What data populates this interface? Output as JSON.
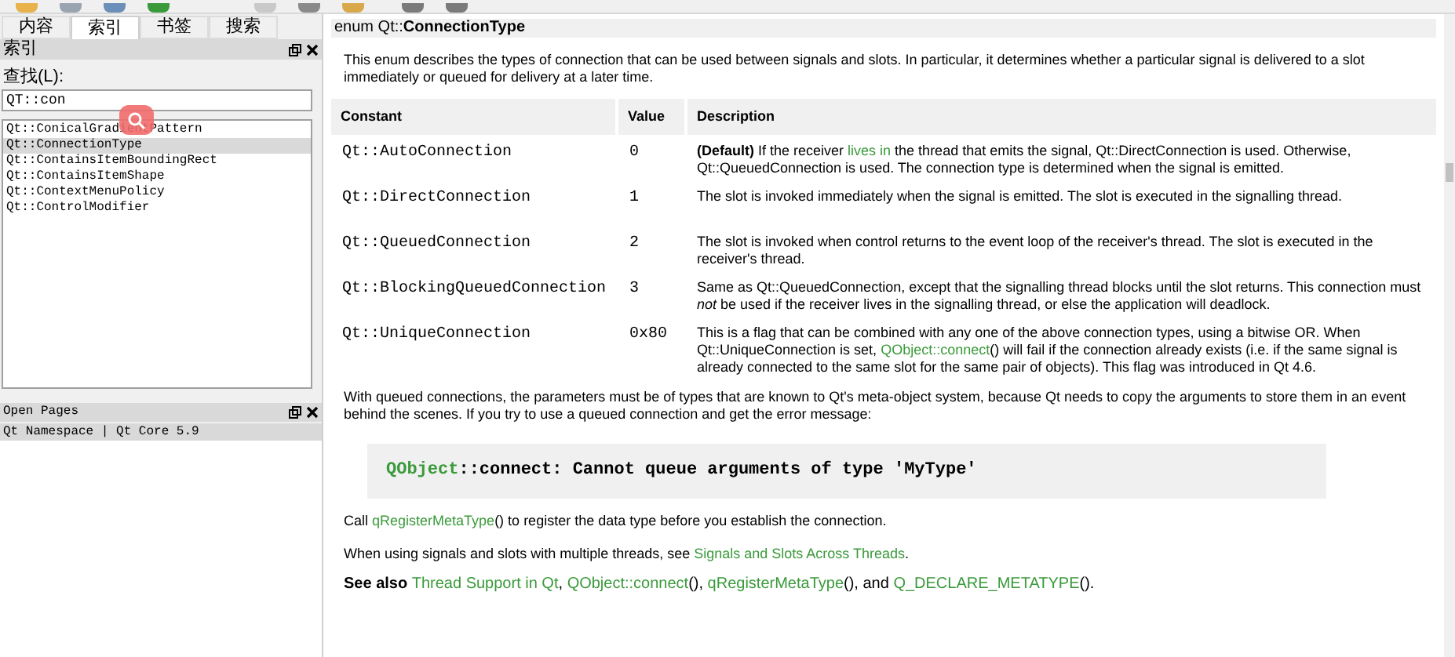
{
  "sidebar": {
    "tabs": [
      {
        "label": "内容",
        "selected": false
      },
      {
        "label": "索引",
        "selected": true
      },
      {
        "label": "书签",
        "selected": false
      },
      {
        "label": "搜索",
        "selected": false
      }
    ],
    "index_panel": {
      "title": "索引",
      "find_label": "查找(L):",
      "search_value": "QT::con",
      "items": [
        {
          "label": "Qt::ConicalGradientPattern",
          "selected": false
        },
        {
          "label": "Qt::ConnectionType",
          "selected": true
        },
        {
          "label": "Qt::ContainsItemBoundingRect",
          "selected": false
        },
        {
          "label": "Qt::ContainsItemShape",
          "selected": false
        },
        {
          "label": "Qt::ContextMenuPolicy",
          "selected": false
        },
        {
          "label": "Qt::ControlModifier",
          "selected": false
        }
      ]
    },
    "open_pages": {
      "title": "Open Pages",
      "items": [
        {
          "label": "Qt Namespace | Qt Core 5.9",
          "selected": true
        }
      ]
    }
  },
  "document": {
    "heading": [
      {
        "kind": "text",
        "text": "enum Qt::"
      },
      {
        "kind": "bold",
        "text": "ConnectionType"
      }
    ],
    "intro": [
      {
        "kind": "text",
        "text": "This enum describes the types of connection that can be used between signals and slots. In particular, it determines whether a particular signal is delivered to a slot immediately or queued for delivery at a later time."
      }
    ],
    "table": {
      "columns": [
        "Constant",
        "Value",
        "Description"
      ],
      "rows": [
        {
          "constant": "Qt::AutoConnection",
          "value": "0",
          "description": [
            {
              "kind": "bold",
              "text": "(Default)"
            },
            {
              "kind": "text",
              "text": " If the receiver "
            },
            {
              "kind": "link",
              "text": "lives in"
            },
            {
              "kind": "text",
              "text": " the thread that emits the signal, Qt::DirectConnection is used. Otherwise, Qt::QueuedConnection is used. The connection type is determined when the signal is emitted."
            }
          ]
        },
        {
          "constant": "Qt::DirectConnection",
          "value": "1",
          "description": [
            {
              "kind": "text",
              "text": "The slot is invoked immediately when the signal is emitted. The slot is executed in the signalling thread."
            }
          ]
        },
        {
          "constant": "Qt::QueuedConnection",
          "value": "2",
          "description": [
            {
              "kind": "text",
              "text": "The slot is invoked when control returns to the event loop of the receiver's thread. The slot is executed in the receiver's thread."
            }
          ]
        },
        {
          "constant": "Qt::BlockingQueuedConnection",
          "value": "3",
          "description": [
            {
              "kind": "text",
              "text": "Same as Qt::QueuedConnection, except that the signalling thread blocks until the slot returns. This connection must "
            },
            {
              "kind": "italic",
              "text": "not"
            },
            {
              "kind": "text",
              "text": " be used if the receiver lives in the signalling thread, or else the application will deadlock."
            }
          ]
        },
        {
          "constant": "Qt::UniqueConnection",
          "value": "0x80",
          "description": [
            {
              "kind": "text",
              "text": "This is a flag that can be combined with any one of the above connection types, using a bitwise OR. When Qt::UniqueConnection is set, "
            },
            {
              "kind": "link",
              "text": "QObject::connect"
            },
            {
              "kind": "text",
              "text": "() will fail if the connection already exists (i.e. if the same signal is already connected to the same slot for the same pair of objects). This flag was introduced in Qt 4.6."
            }
          ]
        }
      ]
    },
    "para_queued": [
      {
        "kind": "text",
        "text": "With queued connections, the parameters must be of types that are known to Qt's meta-object system, because Qt needs to copy the arguments to store them in an event behind the scenes. If you try to use a queued connection and get the error message:"
      }
    ],
    "code": [
      {
        "kind": "link",
        "text": "QObject"
      },
      {
        "kind": "text",
        "text": "::connect: Cannot queue arguments of type 'MyType'"
      }
    ],
    "para_register": [
      {
        "kind": "text",
        "text": "Call "
      },
      {
        "kind": "link",
        "text": "qRegisterMetaType"
      },
      {
        "kind": "text",
        "text": "() to register the data type before you establish the connection."
      }
    ],
    "para_threads": [
      {
        "kind": "text",
        "text": "When using signals and slots with multiple threads, see "
      },
      {
        "kind": "link",
        "text": "Signals and Slots Across Threads"
      },
      {
        "kind": "text",
        "text": "."
      }
    ],
    "see_also": [
      {
        "kind": "bold",
        "text": "See also "
      },
      {
        "kind": "link",
        "text": "Thread Support in Qt"
      },
      {
        "kind": "text",
        "text": ", "
      },
      {
        "kind": "link",
        "text": "QObject::connect"
      },
      {
        "kind": "text",
        "text": "(), "
      },
      {
        "kind": "link",
        "text": "qRegisterMetaType"
      },
      {
        "kind": "text",
        "text": "(), and "
      },
      {
        "kind": "link",
        "text": "Q_DECLARE_METATYPE"
      },
      {
        "kind": "text",
        "text": "()."
      }
    ]
  }
}
